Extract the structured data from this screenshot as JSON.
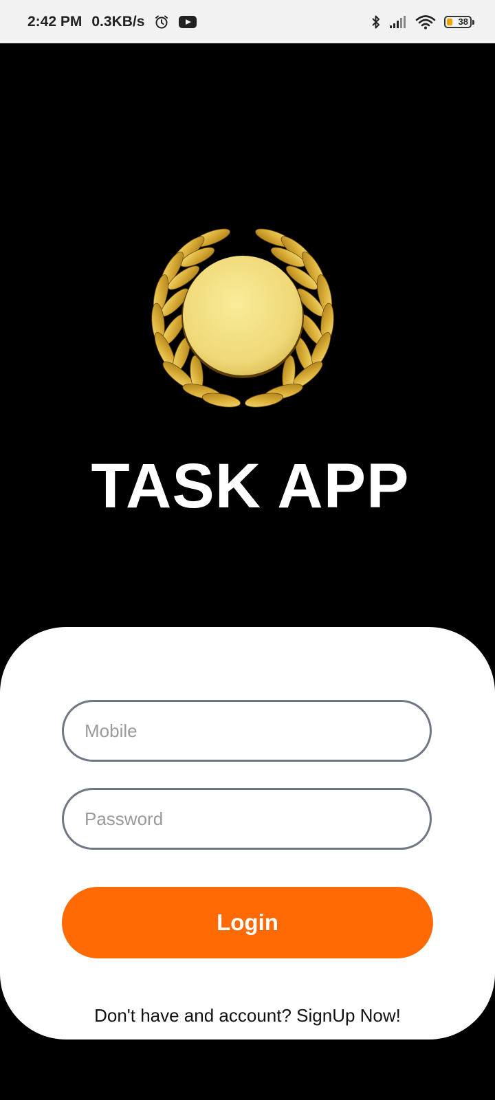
{
  "status_bar": {
    "time": "2:42 PM",
    "speed": "0.3KB/s",
    "battery": "38",
    "icons": [
      "alarm-icon",
      "youtube-icon",
      "bluetooth-icon",
      "signal-icon",
      "wifi-icon",
      "battery-icon"
    ]
  },
  "app": {
    "title": "TASK APP",
    "logo_icon": "laurel-wreath-medal-icon"
  },
  "form": {
    "mobile_placeholder": "Mobile",
    "password_placeholder": "Password",
    "login_label": "Login",
    "signup_text": "Don't have and account? SignUp Now!"
  },
  "colors": {
    "background": "#000000",
    "card": "#ffffff",
    "accent": "#ff6a05",
    "field_border": "#6f7785",
    "gold": "#e9c84a"
  }
}
